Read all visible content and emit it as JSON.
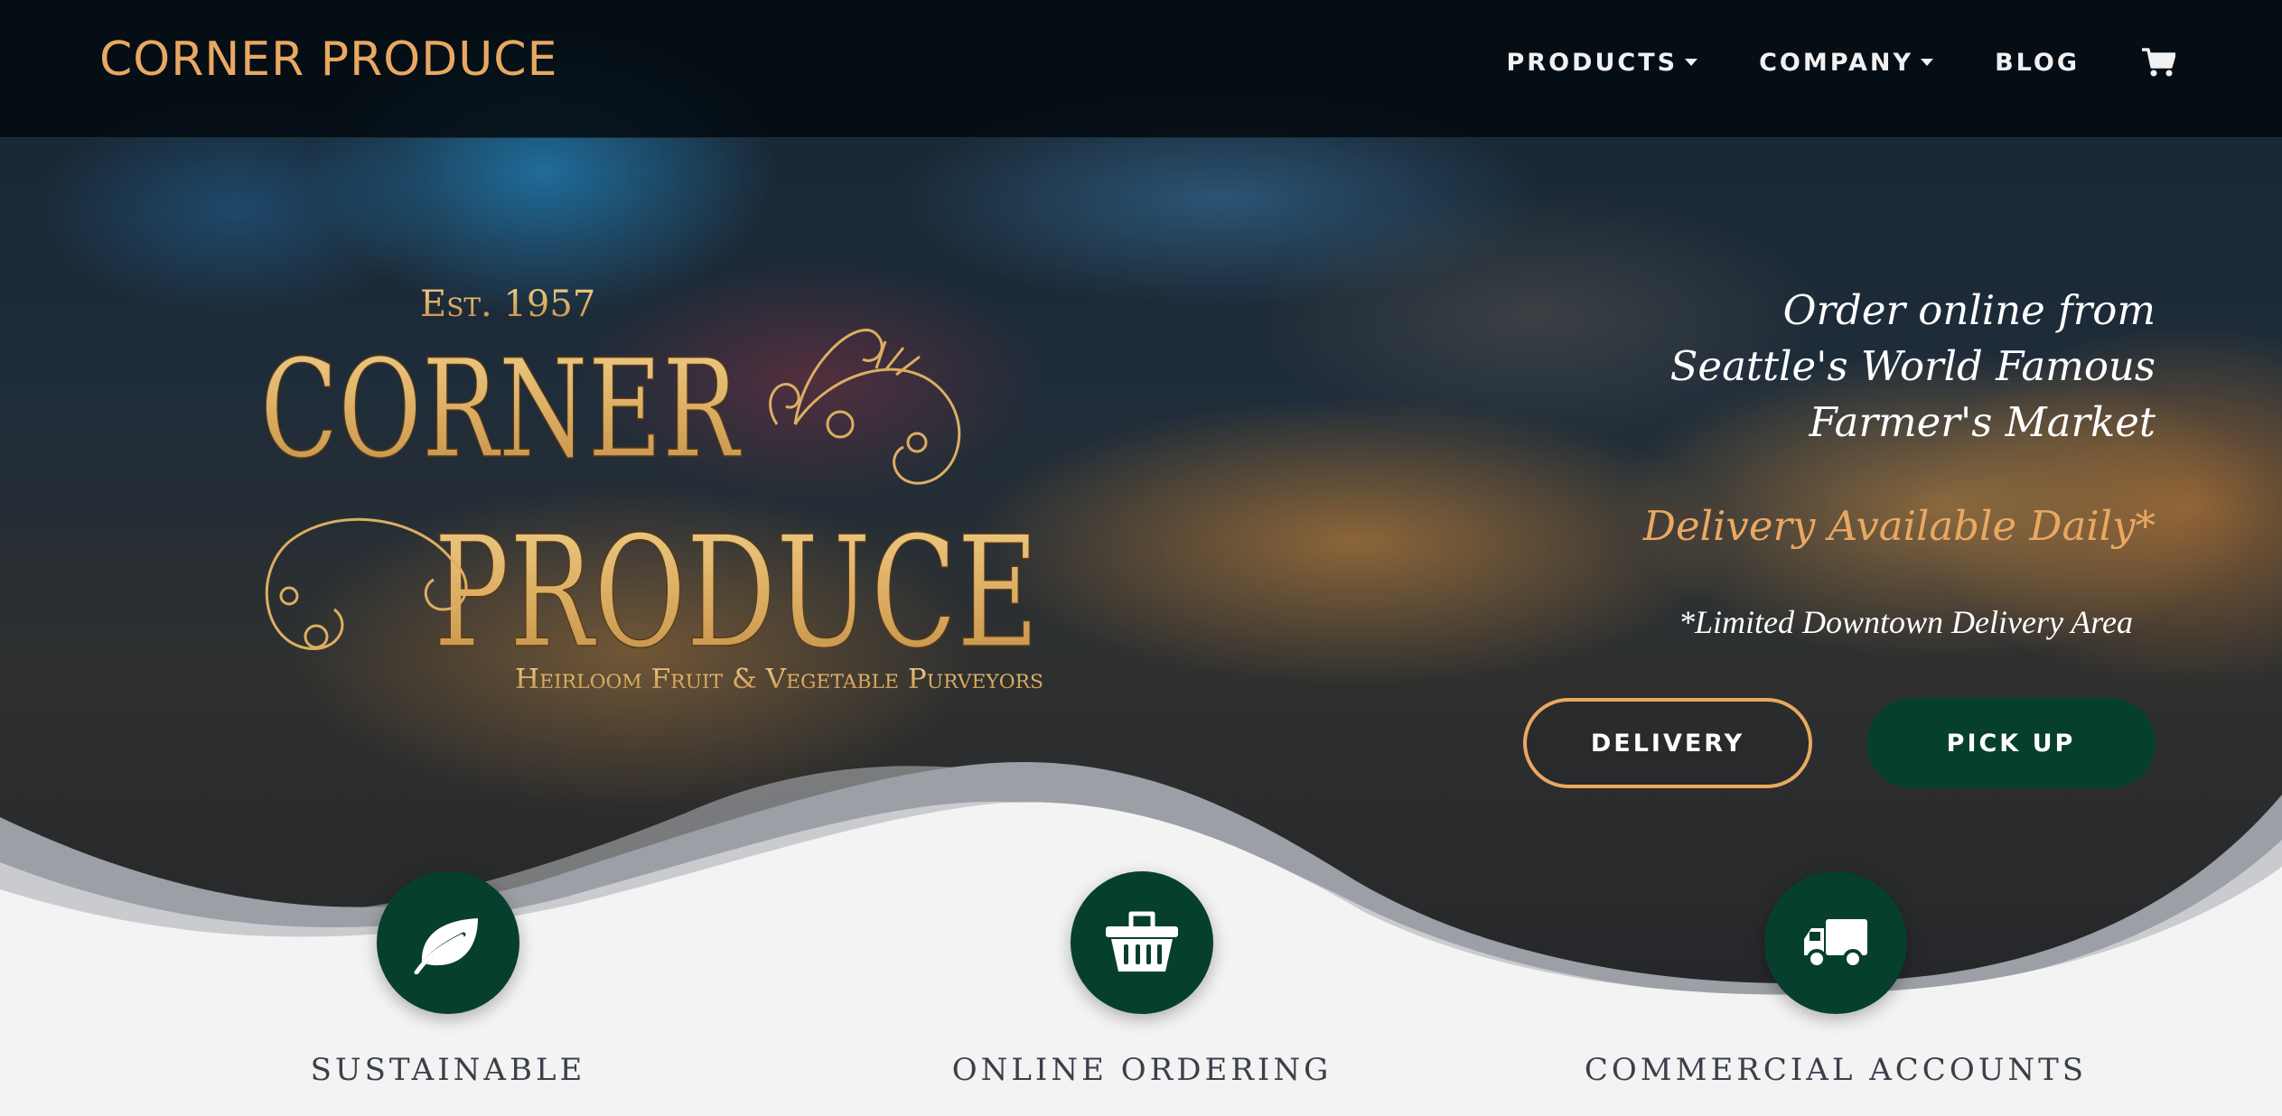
{
  "brand": {
    "name": "CORNER PRODUCE",
    "color": "#e9a862"
  },
  "nav": {
    "items": [
      {
        "label": "PRODUCTS",
        "dropdown": true
      },
      {
        "label": "COMPANY",
        "dropdown": true
      },
      {
        "label": "BLOG",
        "dropdown": false
      }
    ],
    "cart_icon": "shopping-cart-icon"
  },
  "logo": {
    "established": "Est. 1957",
    "line1": "CORNER",
    "line2": "PRODUCE",
    "subline": "Heirloom Fruit & Vegetable Purveyors"
  },
  "hero": {
    "tagline": [
      "Order online from",
      "Seattle's World Famous",
      "Farmer's Market"
    ],
    "delivery_headline": "Delivery Available Daily*",
    "delivery_note": "*Limited Downtown Delivery Area",
    "buttons": {
      "delivery": "DELIVERY",
      "pickup": "PICK UP"
    }
  },
  "features": [
    {
      "label": "SUSTAINABLE",
      "icon": "leaf-icon"
    },
    {
      "label": "ONLINE ORDERING",
      "icon": "basket-icon"
    },
    {
      "label": "COMMERCIAL ACCOUNTS",
      "icon": "truck-icon"
    }
  ],
  "colors": {
    "accent_gold": "#e9a862",
    "dark_green": "#073f2e",
    "navbar_bg": "#05090e",
    "light_bg": "#f3f3f3"
  }
}
